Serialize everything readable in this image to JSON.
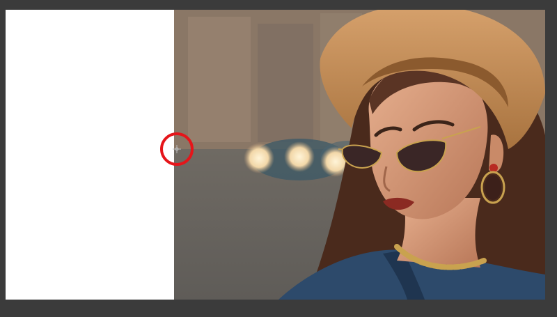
{
  "document": {
    "background_color": "#3b3b3b",
    "fill_color": "#ffffff",
    "highlight_color": "#e5151a"
  },
  "icons": {
    "cursor": "crosshair-move-icon"
  }
}
